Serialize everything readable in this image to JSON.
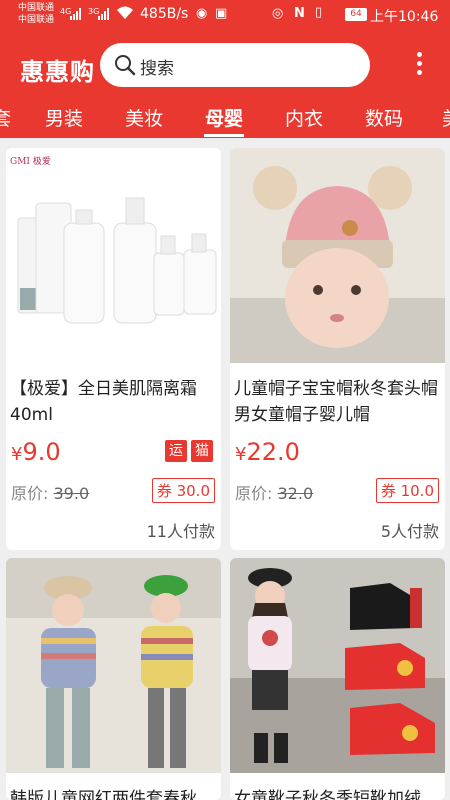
{
  "status": {
    "carrier1": "中国联通",
    "carrier2": "中国联通",
    "sig1": "4G",
    "sig2": "3G",
    "speed": "485B/s",
    "battery": "64",
    "time": "上午10:46"
  },
  "header": {
    "title": "惠惠购",
    "search_placeholder": "搜索"
  },
  "tabs": [
    {
      "label": "套"
    },
    {
      "label": "男装"
    },
    {
      "label": "美妆"
    },
    {
      "label": "母婴"
    },
    {
      "label": "内衣"
    },
    {
      "label": "数码"
    },
    {
      "label": "美"
    }
  ],
  "products": [
    {
      "brand": "GMI 极爱",
      "title": "【极爱】全日美肌隔离霜40ml",
      "currency": "¥",
      "price": "9.0",
      "tags": [
        "运",
        "猫"
      ],
      "orig_label": "原价:",
      "orig_price": "39.0",
      "coupon": "券 30.0",
      "paid": "11人付款"
    },
    {
      "title": "儿童帽子宝宝帽秋冬套头帽男女童帽子婴儿帽",
      "currency": "¥",
      "price": "22.0",
      "orig_label": "原价:",
      "orig_price": "32.0",
      "coupon": "券 10.0",
      "paid": "5人付款"
    },
    {
      "title": "韩版儿童网红两件套春秋"
    },
    {
      "title": "女童靴子秋冬季短靴加绒"
    }
  ],
  "colors": {
    "brand": "#e8382f",
    "background": "#efefef"
  }
}
